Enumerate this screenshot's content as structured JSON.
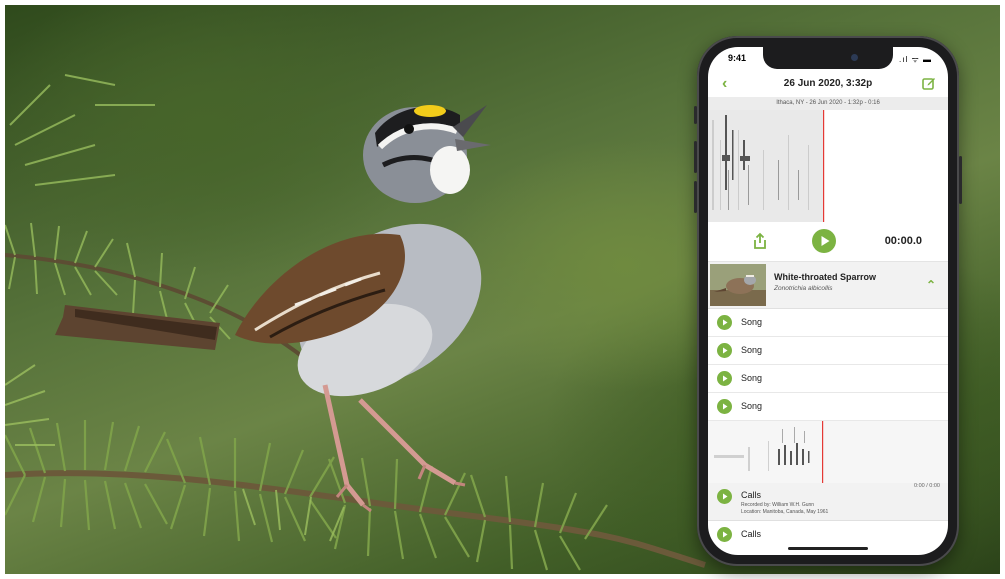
{
  "status_bar": {
    "time": "9:41",
    "icons": ".ıl ᯤ ▬"
  },
  "nav": {
    "title": "26 Jun 2020, 3:32p"
  },
  "recording_info": "Ithaca, NY - 26 Jun 2020 - 1:32p - 0:16",
  "player": {
    "timer": "00:00.0"
  },
  "species": {
    "common_name": "White-throated Sparrow",
    "scientific_name": "Zonotrichia albicollis"
  },
  "sounds": [
    {
      "label": "Song"
    },
    {
      "label": "Song"
    },
    {
      "label": "Song"
    },
    {
      "label": "Song"
    }
  ],
  "calls_detail": {
    "label": "Calls",
    "time": "0:00 / 0:00",
    "recorded_by": "Recorded by: William W.H. Gunn",
    "location": "Location: Manitoba, Canada, May 1961"
  },
  "calls_row": {
    "label": "Calls"
  },
  "colors": {
    "accent": "#7cb342",
    "playhead": "#e53935"
  }
}
